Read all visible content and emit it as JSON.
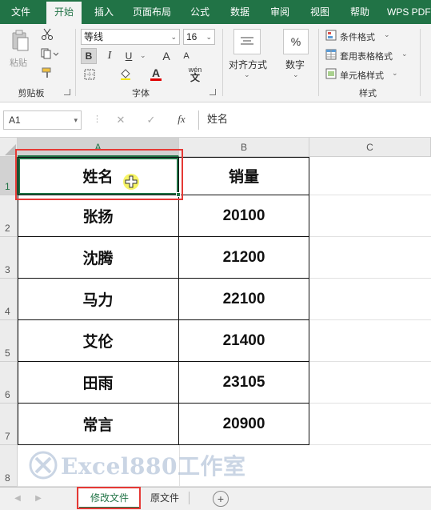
{
  "ribbon_tabs": [
    "文件",
    "开始",
    "插入",
    "页面布局",
    "公式",
    "数据",
    "审阅",
    "视图",
    "帮助",
    "WPS PDF"
  ],
  "active_tab_index": 1,
  "clipboard": {
    "paste_label": "粘贴",
    "group_label": "剪贴板"
  },
  "font": {
    "name": "等线",
    "size": "16",
    "bold_label": "B",
    "italic_label": "I",
    "underline_label": "U",
    "grow_label": "A",
    "shrink_label": "A",
    "fontcolor_label": "A",
    "phonetic_label": "wén",
    "group_label": "字体"
  },
  "alignment": {
    "label": "对齐方式"
  },
  "number": {
    "symbol": "%",
    "label": "数字"
  },
  "styles": {
    "items": [
      "条件格式",
      "套用表格格式",
      "单元格样式"
    ],
    "group_label": "样式"
  },
  "formula_bar": {
    "cell_ref": "A1",
    "fx": "fx",
    "content": "姓名"
  },
  "columns": [
    "A",
    "B",
    "C"
  ],
  "rows": [
    "1",
    "2",
    "3",
    "4",
    "5",
    "6",
    "7",
    "8"
  ],
  "table": {
    "header": [
      "姓名",
      "销量"
    ],
    "rows": [
      [
        "张扬",
        "20100"
      ],
      [
        "沈腾",
        "21200"
      ],
      [
        "马力",
        "22100"
      ],
      [
        "艾伦",
        "21400"
      ],
      [
        "田雨",
        "23105"
      ],
      [
        "常言",
        "20900"
      ]
    ]
  },
  "sheets": [
    "修改文件",
    "原文件"
  ],
  "active_sheet_index": 0,
  "watermark": "Excel880工作室",
  "colors": {
    "brand": "#217346",
    "highlight_box": "#e53935",
    "cursor": "#f5f24a"
  }
}
